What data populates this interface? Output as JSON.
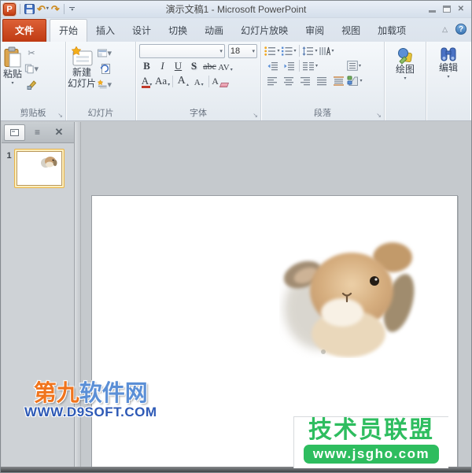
{
  "window": {
    "title": "演示文稿1 - Microsoft PowerPoint",
    "logo_letter": "P"
  },
  "icons": {
    "caret_down": "▾",
    "collapse_ribbon": "△",
    "help": "?",
    "close": "✕",
    "scissors": "✂",
    "undo": "↶",
    "redo": "↷",
    "launcher": "↘",
    "outline_lines": "≡"
  },
  "tabs": {
    "file": "文件",
    "items": [
      "开始",
      "插入",
      "设计",
      "切换",
      "动画",
      "幻灯片放映",
      "审阅",
      "视图",
      "加载项"
    ]
  },
  "ribbon": {
    "clipboard": {
      "paste": "粘贴",
      "label": "剪贴板"
    },
    "slides": {
      "new_slide_line1": "新建",
      "new_slide_line2": "幻灯片",
      "label": "幻灯片"
    },
    "font": {
      "size": "18",
      "bold": "B",
      "italic": "I",
      "underline": "U",
      "shadow": "S",
      "strike": "abc",
      "spacing": "AV",
      "color": "A",
      "case_btn": "Aa",
      "grow": "A",
      "shrink": "A",
      "label": "字体"
    },
    "paragraph": {
      "label": "段落"
    },
    "drawing": {
      "label": "绘图"
    },
    "editing": {
      "label": "编辑"
    }
  },
  "slide_panel": {
    "slide_number": "1"
  },
  "watermarks": {
    "d9soft": {
      "part_orange": "第九",
      "part_blue": "软件网",
      "url": "WWW.D9SOFT.COM"
    },
    "jsgho": {
      "title": "技术员联盟",
      "url": "www.jsgho.com"
    }
  },
  "colors": {
    "file_tab_orange": "#c94f1d",
    "selected_thumb_border": "#e9b347",
    "badge_green": "#2ebd5f",
    "watermark_orange": "#f0741d",
    "watermark_blue": "#5b8fd6",
    "watermark_url_blue": "#2d59b6",
    "workspace_gray": "#c5c9cd"
  }
}
